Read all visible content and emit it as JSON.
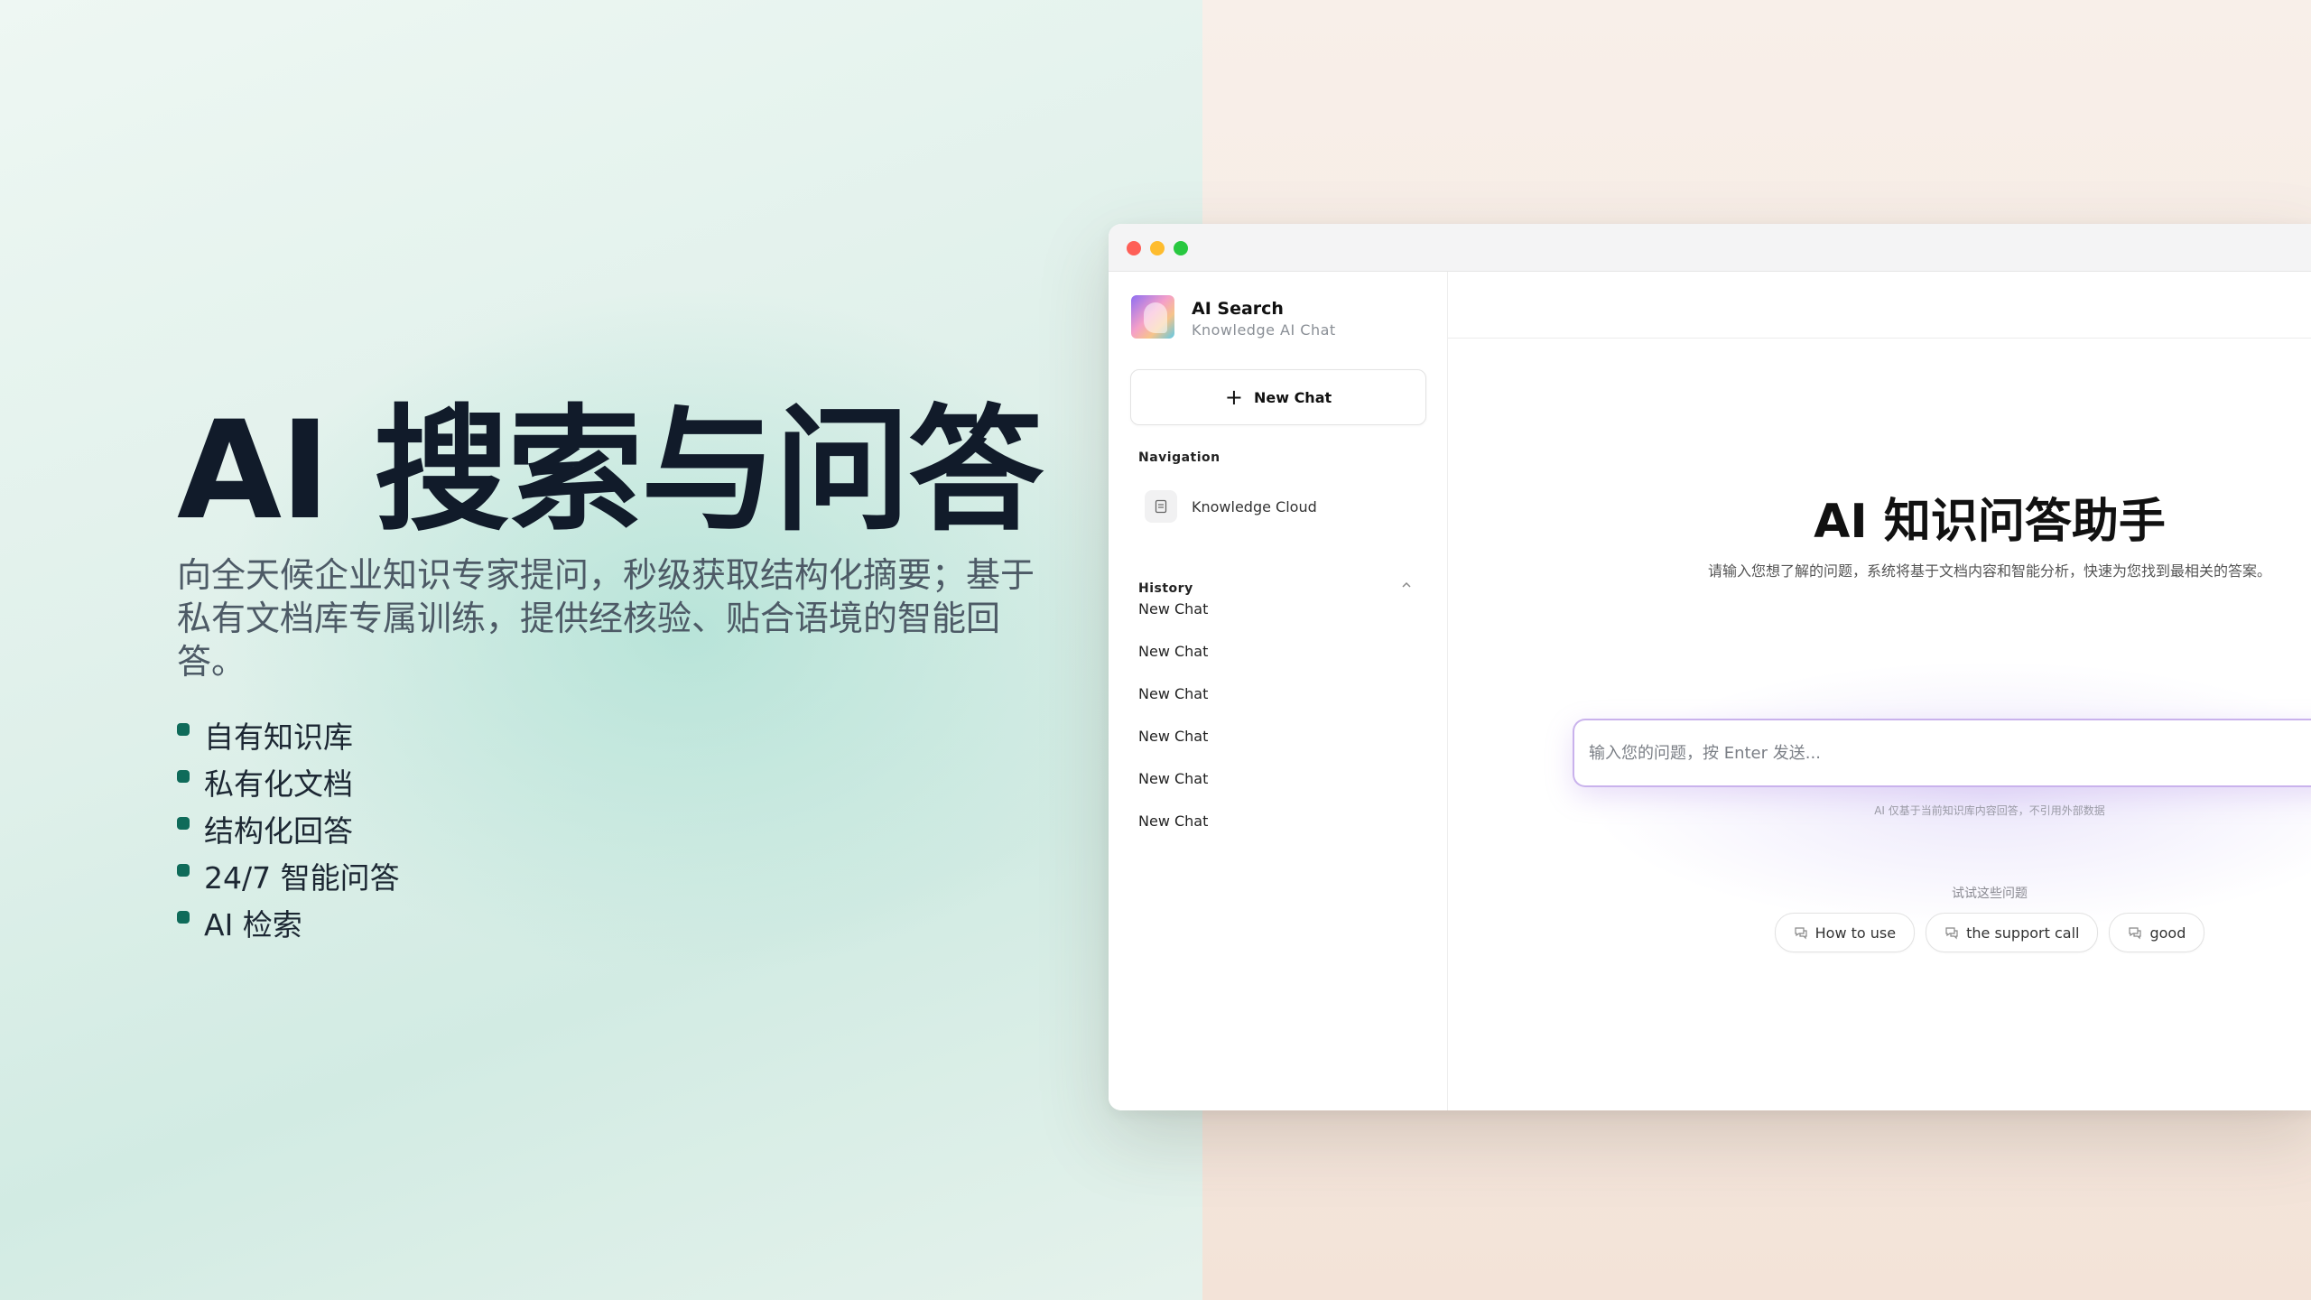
{
  "hero": {
    "title": "AI 搜索与问答",
    "description": "向全天候企业知识专家提问，秒级获取结构化摘要；基于私有文档库专属训练，提供经核验、贴合语境的智能回答。",
    "features": [
      "自有知识库",
      "私有化文档",
      "结构化回答",
      "24/7 智能问答",
      "AI 检索"
    ],
    "accent_color": "#0f6b5a"
  },
  "window": {
    "traffic_lights": [
      "close",
      "minimize",
      "maximize"
    ]
  },
  "sidebar": {
    "brand": {
      "title": "AI Search",
      "subtitle": "Knowledge AI Chat"
    },
    "new_chat_label": "New Chat",
    "navigation_label": "Navigation",
    "nav_items": [
      {
        "label": "Knowledge Cloud",
        "icon": "document-icon"
      }
    ],
    "history_label": "History",
    "history": [
      "New Chat",
      "New Chat",
      "New Chat",
      "New Chat",
      "New Chat",
      "New Chat"
    ]
  },
  "main": {
    "title": "AI 知识问答助手",
    "subtitle": "请输入您想了解的问题，系统将基于文档内容和智能分析，快速为您找到最相关的答案。",
    "input_placeholder": "输入您的问题，按 Enter 发送...",
    "input_hint": "AI 仅基于当前知识库内容回答，不引用外部数据",
    "suggest_label": "试试这些问题",
    "suggestions": [
      "How to use",
      "the support call",
      "good"
    ]
  }
}
